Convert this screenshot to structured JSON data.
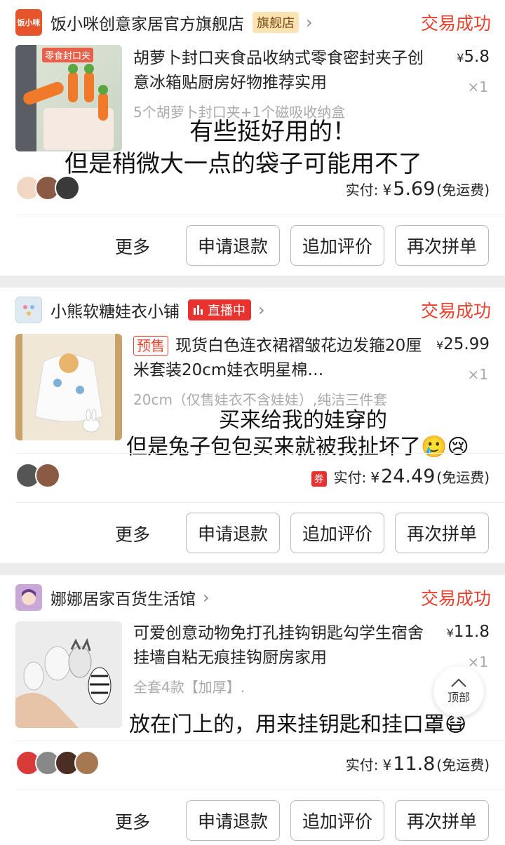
{
  "orders": [
    {
      "shop": {
        "logo_text": "饭小咪",
        "name": "饭小咪创意家居官方旗舰店",
        "badge": "旗舰店"
      },
      "status": "交易成功",
      "thumb_caption": "零食封口夹",
      "title": "胡萝卜封口夹食品收纳式零食密封夹子创意冰箱贴厨房好物推荐实用",
      "price": "5.8",
      "qty": "×1",
      "spec": "5个胡萝卜封口夹+1个磁吸收纳盒",
      "overlay_line1": "有些挺好用的！",
      "overlay_line2": "但是稍微大一点的袋子可能用不了",
      "paid_label": "实付:",
      "paid_amount": "5.69",
      "shipping": "(免运费)",
      "actions": {
        "more": "更多",
        "refund": "申请退款",
        "review": "追加评价",
        "reorder": "再次拼单"
      }
    },
    {
      "shop": {
        "name": "小熊软糖娃衣小铺",
        "badge": "直播中"
      },
      "status": "交易成功",
      "presale": "预售",
      "title": "现货白色连衣裙褶皱花边发箍20厘米套装20cm娃衣明星棉…",
      "price": "25.99",
      "qty": "×1",
      "spec": "20cm（仅售娃衣不含娃娃）,纯洁三件套",
      "overlay_line1": "买来给我的娃穿的",
      "overlay_line2": "但是兔子包包买来就被我扯坏了🥲😢",
      "coupon": "券",
      "paid_label": "实付:",
      "paid_amount": "24.49",
      "shipping": "(免运费)",
      "actions": {
        "more": "更多",
        "refund": "申请退款",
        "review": "追加评价",
        "reorder": "再次拼单"
      }
    },
    {
      "shop": {
        "name": "娜娜居家百货生活馆"
      },
      "status": "交易成功",
      "title": "可爱创意动物免打孔挂钩钥匙勾学生宿舍挂墙自粘无痕挂钩厨房家用",
      "price": "11.8",
      "qty": "×1",
      "spec": "全套4款【加厚】.",
      "overlay_line1": "放在门上的，用来挂钥匙和挂口罩😷",
      "paid_label": "实付:",
      "paid_amount": "11.8",
      "shipping": "(免运费)",
      "actions": {
        "more": "更多",
        "refund": "申请退款",
        "review": "追加评价",
        "reorder": "再次拼单"
      }
    }
  ],
  "currency": "¥",
  "back_to_top": "顶部",
  "colors": {
    "status": "#e8412e",
    "live_badge": "#e8322f",
    "flag_badge": "#fbe3b3"
  }
}
